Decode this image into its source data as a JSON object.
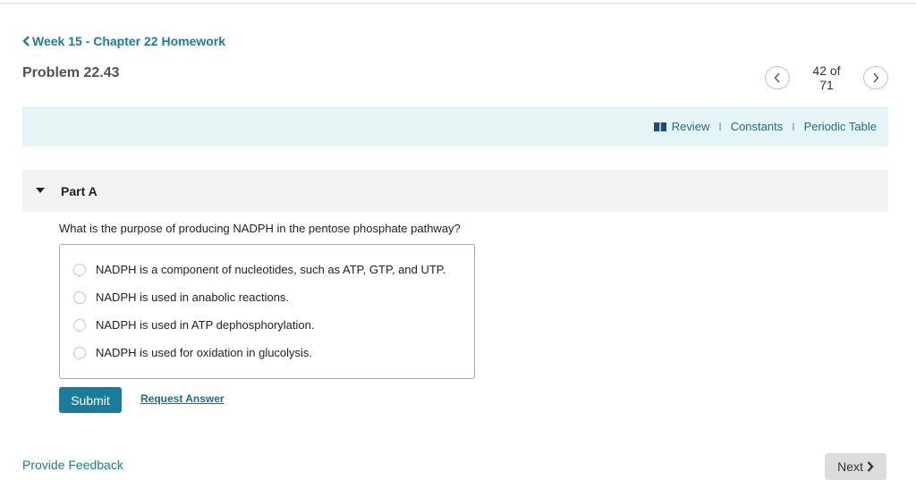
{
  "breadcrumb": {
    "label": "Week 15 - Chapter 22 Homework",
    "icon": "chevron-left-icon"
  },
  "problem": {
    "title": "Problem 22.43"
  },
  "pager": {
    "current": "42 of 71",
    "prev_icon": "chevron-left-icon",
    "next_icon": "chevron-right-icon"
  },
  "resources": {
    "icon": "book-icon",
    "links": [
      "Review",
      "Constants",
      "Periodic Table"
    ],
    "separator": "I"
  },
  "part": {
    "title": "Part A",
    "expanded": true,
    "question": "What is the purpose of producing NADPH in the pentose phosphate pathway?",
    "options": [
      {
        "label": "NADPH is a component of nucleotides, such as ATP, GTP, and UTP.",
        "selected": false
      },
      {
        "label": "NADPH is used in anabolic reactions.",
        "selected": false
      },
      {
        "label": "NADPH is used in ATP dephosphorylation.",
        "selected": false
      },
      {
        "label": "NADPH is used for oxidation in glucolysis.",
        "selected": false
      }
    ],
    "submit_label": "Submit",
    "request_answer_label": "Request Answer"
  },
  "footer": {
    "feedback_label": "Provide Feedback",
    "next_label": "Next"
  },
  "colors": {
    "accent": "#1a7c9c",
    "link": "#1b7aa0",
    "resource_bg": "#e5f5f6",
    "part_bg": "#f3f3f3"
  }
}
